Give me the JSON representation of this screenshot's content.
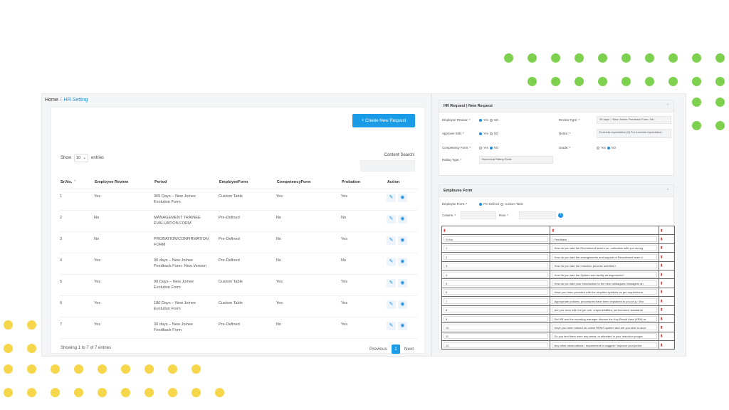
{
  "breadcrumb": {
    "home": "Home",
    "sep": "/",
    "current": "HR Setting"
  },
  "toolbar": {
    "create_label": "+ Create New Request"
  },
  "table_controls": {
    "show_label": "Show",
    "entries_value": "10",
    "entries_label": "entries",
    "search_label": "Content Search:"
  },
  "columns": [
    "Sr.No.",
    "Employee Review",
    "Period",
    "EmployeeForm",
    "CompetencyForm",
    "Probation",
    "Action"
  ],
  "rows": [
    {
      "sr": "1",
      "review": "Yes",
      "period": "365 Days – New Joinee Evolution Form",
      "form": "Custom Table",
      "competency": "Yes",
      "probation": "Yes"
    },
    {
      "sr": "2",
      "review": "No",
      "period": "MANAGEMENT TRAINEE EVALUATION FORM",
      "form": "Pre-Defined",
      "competency": "No",
      "probation": "No"
    },
    {
      "sr": "3",
      "review": "No",
      "period": "PROBATION/CONFIRMATION FORM",
      "form": "Pre-Defined",
      "competency": "No",
      "probation": "Yes"
    },
    {
      "sr": "4",
      "review": "Yes",
      "period": "30 days – New Joinee Feedback Form- New Version",
      "form": "Pre-Defined",
      "competency": "No",
      "probation": "No"
    },
    {
      "sr": "5",
      "review": "Yes",
      "period": "90 Days – New Joinee Evolution Form",
      "form": "Custom Table",
      "competency": "Yes",
      "probation": "Yes"
    },
    {
      "sr": "6",
      "review": "Yes",
      "period": "180 Days – New Joinee Evolution Form",
      "form": "Custom Table",
      "competency": "Yes",
      "probation": "Yes"
    },
    {
      "sr": "7",
      "review": "Yes",
      "period": "30 days – New Joinee Feedback Form",
      "form": "Pre-Defined",
      "competency": "No",
      "probation": "Yes"
    }
  ],
  "footer": {
    "info": "Showing 1 to 7 of 7 entries",
    "previous": "Previous",
    "page": "1",
    "next": "Next"
  },
  "hr_panel": {
    "title": "HR Request | New Request",
    "employee_review_label": "Employee Review: *",
    "approver_edit_label": "Approver Edit: *",
    "competency_form_label": "Competency Form: *",
    "rating_type_label": "Rating Type: *",
    "rating_type_value": "Numerical Rating Scale",
    "review_type_label": "Review Type: *",
    "review_type_value": "30 days – New Joinee Feedback Form- Ne...",
    "notice_label": "Notice: *",
    "notice_value": "Exceeds expectation (5) For exceeds expectation.",
    "grade_label": "Grade: *",
    "yes": "Yes",
    "no": "NO"
  },
  "employee_form": {
    "title": "Employee Form",
    "type_label": "Employee Form: *",
    "opt_predefined": "Pre-Defined",
    "opt_custom": "Custom Table",
    "column_label": "Column: *",
    "row_label": "Row: *",
    "header_left": "Sr.No",
    "header_right": "Feedback",
    "questions": [
      {
        "n": "1",
        "q": "How do you rate the Recruitment team's co- ordination with you during"
      },
      {
        "n": "2",
        "q": "How do you rate the arrangements and support of Recruitment team d"
      },
      {
        "n": "3",
        "q": "How do you rate the Induction process activities?"
      },
      {
        "n": "4",
        "q": "How do you rate the System and facility arrangements?"
      },
      {
        "n": "5",
        "q": "How do you rate your introduction to the new colleagues, Managers an"
      },
      {
        "n": "6",
        "q": "Have you been provided with the required systems as per requirement"
      },
      {
        "n": "7",
        "q": "Appropriate policies, procedures have been explained to you (e.g.: Wor"
      },
      {
        "n": "8",
        "q": "Are you clear with the job role, responsibilities, performance standards"
      },
      {
        "n": "9",
        "q": "Did HR and the reporting manager discuss the Key Result Area (KRA) wi"
      },
      {
        "n": "10",
        "q": "Have you been trained on online HRMS system and are you able to acce"
      },
      {
        "n": "11",
        "q": "Do you feel there were any areas un attended in your induction progra"
      },
      {
        "n": "12",
        "q": "Any other observations / requirement to suggest / improve your perfor"
      }
    ]
  },
  "colors": {
    "accent": "#1a9be8",
    "dot_green": "#7dd14e",
    "dot_yellow": "#f6d64a",
    "delete": "#e23b3b"
  },
  "icons": {
    "edit": "pencil-icon",
    "view": "eye-icon",
    "delete": "trash-icon",
    "collapse": "chevron-up-icon",
    "add": "plus-circle-icon"
  }
}
